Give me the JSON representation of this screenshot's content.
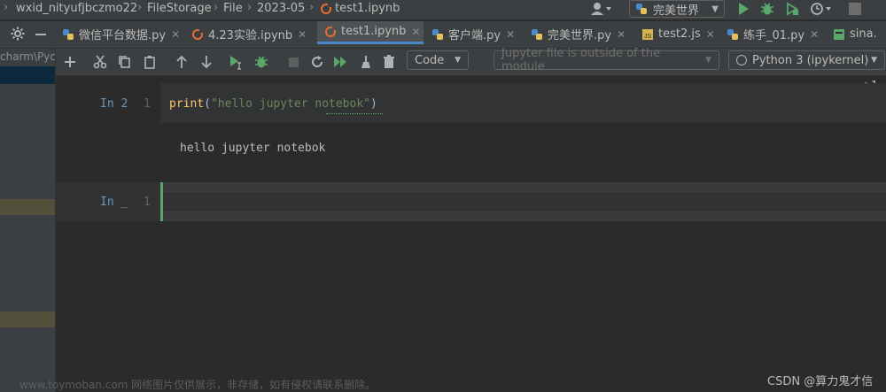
{
  "breadcrumb": {
    "items": [
      "wxid_nityufjbczmo22",
      "FileStorage",
      "File",
      "2023-05",
      "test1.ipynb"
    ],
    "separator": "›"
  },
  "run_config": {
    "label": "完美世界"
  },
  "tabs": [
    {
      "label": "微信平台数据.py",
      "icon": "python-file-icon"
    },
    {
      "label": "4.23实验.ipynb",
      "icon": "notebook-file-icon"
    },
    {
      "label": "test1.ipynb",
      "icon": "notebook-file-icon",
      "active": true
    },
    {
      "label": "客户端.py",
      "icon": "python-file-icon"
    },
    {
      "label": "完美世界.py",
      "icon": "python-file-icon"
    },
    {
      "label": "test2.js",
      "icon": "js-file-icon"
    },
    {
      "label": "练手_01.py",
      "icon": "python-file-icon"
    },
    {
      "label": "sina.",
      "icon": "html-file-icon"
    }
  ],
  "sidebar": {
    "path_fragment": "charm\\Pyc"
  },
  "notebook_toolbar": {
    "cell_type": "Code",
    "module_notice": "Jupyter file is outside of the module",
    "kernel": "Python 3 (ipykernel)"
  },
  "inspections": {
    "count": "1"
  },
  "cells": [
    {
      "prompt": "In 2",
      "line_number": "1",
      "code": {
        "func": "print",
        "open": "(",
        "string": "\"hello jupyter notebok\"",
        "close": ")"
      },
      "output": "hello jupyter notebok"
    },
    {
      "prompt": "In _",
      "line_number": "1",
      "code": ""
    }
  ],
  "watermark": {
    "left": "www.toymoban.com 网络图片仅供展示，非存储，如有侵权请联系删除。",
    "right": "CSDN @算力鬼才信"
  },
  "colors": {
    "background": "#2b2b2b",
    "panel": "#3c3f41",
    "accent": "#4a88c7",
    "keyword": "#ffc66d",
    "string": "#6a8759",
    "run_green": "#59a869",
    "active_cell_bar": "#59a869"
  }
}
